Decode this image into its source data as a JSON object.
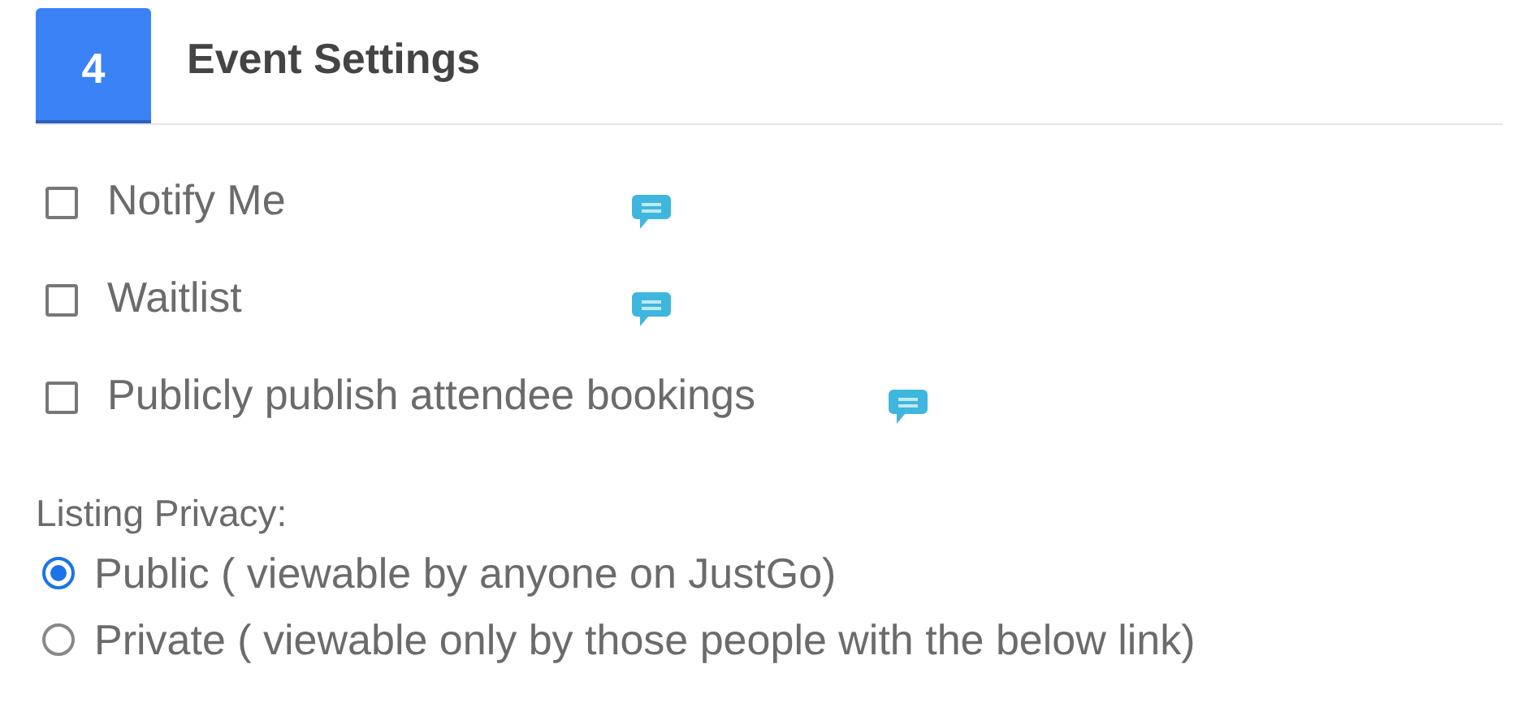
{
  "section": {
    "number": "4",
    "title": "Event Settings"
  },
  "options": [
    {
      "label": "Notify Me",
      "checked": false
    },
    {
      "label": "Waitlist",
      "checked": false
    },
    {
      "label": "Publicly publish attendee bookings",
      "checked": false
    }
  ],
  "listing_privacy": {
    "label": "Listing Privacy:",
    "choices": [
      {
        "label": "Public ( viewable by anyone on JustGo)",
        "selected": true
      },
      {
        "label": "Private ( viewable only by those people with the below link)",
        "selected": false
      }
    ]
  }
}
